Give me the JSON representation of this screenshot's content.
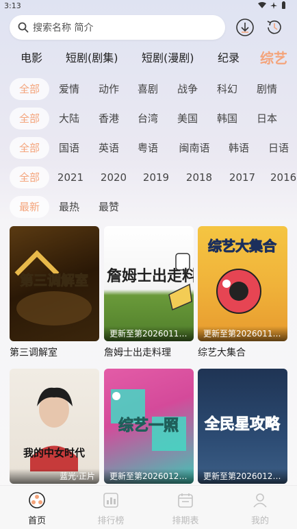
{
  "status": {
    "time": "3:13"
  },
  "search": {
    "placeholder": "搜索名称 简介"
  },
  "category_tabs": [
    "电影",
    "短剧(剧集)",
    "短剧(漫剧)",
    "纪录",
    "综艺"
  ],
  "filters": {
    "genre": [
      "全部",
      "爱情",
      "动作",
      "喜剧",
      "战争",
      "科幻",
      "剧情"
    ],
    "region": [
      "全部",
      "大陆",
      "香港",
      "台湾",
      "美国",
      "韩国",
      "日本"
    ],
    "language": [
      "全部",
      "国语",
      "英语",
      "粤语",
      "闽南语",
      "韩语",
      "日语"
    ],
    "year": [
      "全部",
      "2021",
      "2020",
      "2019",
      "2018",
      "2017",
      "2016"
    ],
    "sort": [
      "最新",
      "最热",
      "最赞"
    ]
  },
  "cards": [
    {
      "title": "第三调解室",
      "caption": "",
      "poster_text": "第三调解室"
    },
    {
      "title": "詹姆士出走料理",
      "caption": "更新至第2026011…",
      "poster_text": "詹姆士出走料理"
    },
    {
      "title": "综艺大集合",
      "caption": "更新至第2026011…",
      "poster_text": "综艺大集合"
    },
    {
      "title": "",
      "caption": "蓝光·正片",
      "poster_text": "我的中女时代"
    },
    {
      "title": "",
      "caption": "更新至第2026012…",
      "poster_text": "综艺一照"
    },
    {
      "title": "",
      "caption": "更新至第2026012…",
      "poster_text": "全民星攻略"
    }
  ],
  "nav": [
    "首页",
    "排行榜",
    "排期表",
    "我的"
  ],
  "colors": {
    "accent": "#f4a47b",
    "active_nav": "#222222",
    "inactive_nav": "#bbbbbb"
  }
}
